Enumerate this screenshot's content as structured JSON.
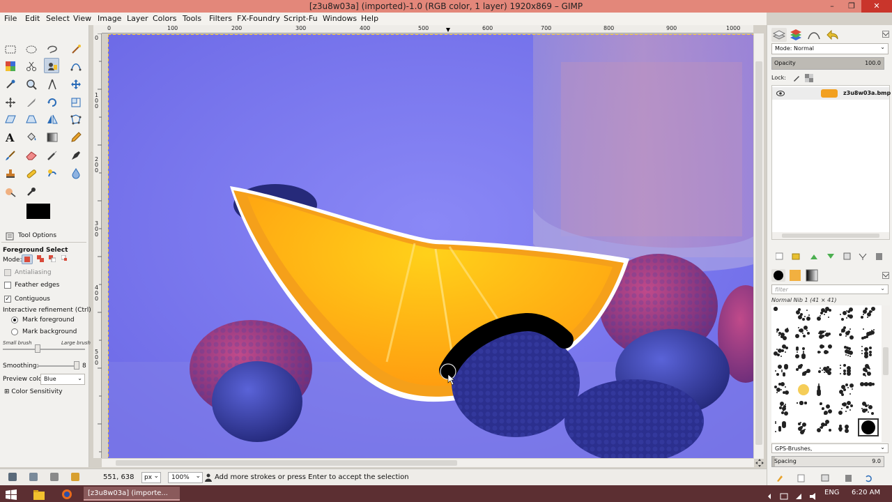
{
  "window": {
    "title": "[z3u8w03a] (imported)-1.0 (RGB color, 1 layer) 1920x869 – GIMP",
    "minimize": "–",
    "maximize": "❐",
    "close": "✕"
  },
  "menu": [
    "File",
    "Edit",
    "Select",
    "View",
    "Image",
    "Layer",
    "Colors",
    "Tools",
    "Filters",
    "FX-Foundry",
    "Script-Fu",
    "Windows",
    "Help"
  ],
  "ruler": {
    "top": [
      "0",
      "100",
      "200",
      "300",
      "400",
      "500",
      "600",
      "700",
      "800",
      "900",
      "1000"
    ],
    "left": [
      "0",
      "1",
      "0",
      "0",
      "2",
      "0",
      "0",
      "3",
      "0",
      "0",
      "4",
      "0",
      "0",
      "5",
      "0",
      "0"
    ]
  },
  "tool_options": {
    "tab_label": "Tool Options",
    "tool_name": "Foreground Select",
    "mode_label": "Mode:",
    "antialiasing": "Antialiasing",
    "feather_edges": "Feather edges",
    "contiguous": "Contiguous",
    "interactive_refinement": "Interactive refinement  (Ctrl)",
    "mark_foreground": "Mark foreground",
    "mark_background": "Mark background",
    "small_brush": "Small brush",
    "large_brush": "Large brush",
    "smoothing_label": "Smoothing:",
    "smoothing_value": "8",
    "preview_color_label": "Preview color:",
    "preview_color_value": "Blue",
    "color_sensitivity": "Color Sensitivity",
    "contiguous_checked": true,
    "mark_foreground_selected": true
  },
  "status": {
    "coords": "551, 638",
    "unit": "px",
    "zoom": "100%",
    "message": "Add more strokes or press Enter to accept the selection"
  },
  "layers": {
    "mode_label": "Mode: Normal",
    "opacity_label": "Opacity",
    "opacity_value": "100.0",
    "opacity_fraction": 1.0,
    "lock_label": "Lock:",
    "layer_name": "z3u8w03a.bmp"
  },
  "brushes": {
    "filter_placeholder": "filter",
    "brush_name": "Normal Nib 1 (41 × 41)",
    "tag_field": "GPS-Brushes,",
    "spacing_label": "Spacing",
    "spacing_value": "9.0"
  },
  "taskbar": {
    "task_label": "[z3u8w03a] (importe...",
    "lang": "ENG",
    "time": "6:20 AM"
  },
  "colors": {
    "titlebar": "#e3877a",
    "canvas_bg": "#7b78f0",
    "taskbar": "#5c2f32"
  }
}
